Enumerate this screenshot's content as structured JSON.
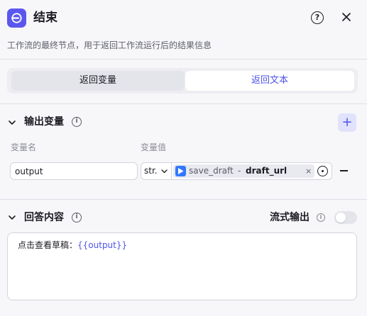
{
  "header": {
    "title": "结束",
    "help_glyph": "?",
    "description": "工作流的最终节点，用于返回工作流运行后的结果信息",
    "icon": "end-node-icon",
    "accent_color": "#5a57ef"
  },
  "tabs": {
    "items": [
      {
        "label": "返回变量",
        "selected": false
      },
      {
        "label": "返回文本",
        "selected": true
      }
    ],
    "active_color": "#4d53e8"
  },
  "output_section": {
    "title": "输出变量",
    "info_glyph": "i",
    "add_label": "+",
    "col_name": "变量名",
    "col_value": "变量值",
    "rows": [
      {
        "name": "output",
        "type": "str.",
        "ref_node": "save_draft",
        "ref_separator": "-",
        "ref_var": "draft_url",
        "clear_label": "×"
      }
    ]
  },
  "answer_section": {
    "title": "回答内容",
    "info_glyph": "i",
    "stream_label": "流式输出",
    "stream_enabled": false,
    "content_prefix": "点击查看草稿：",
    "content_var": "{{output}}"
  }
}
